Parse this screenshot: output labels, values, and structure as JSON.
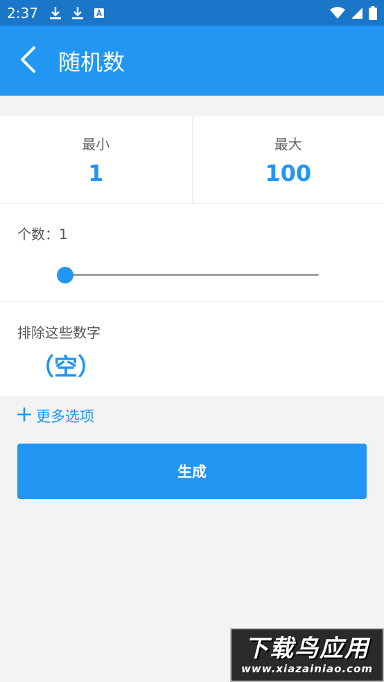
{
  "status_bar": {
    "time": "2:37",
    "left_icons": [
      "download-icon",
      "download-icon",
      "text-icon"
    ],
    "right_icons": [
      "wifi-icon",
      "signal-icon",
      "battery-icon"
    ]
  },
  "app_bar": {
    "title": "随机数",
    "back_icon": "chevron-left-icon"
  },
  "range": {
    "min_label": "最小",
    "min_value": "1",
    "max_label": "最大",
    "max_value": "100"
  },
  "count": {
    "label": "个数：1",
    "slider_fraction": 0
  },
  "exclude": {
    "label": "排除这些数字",
    "value": "（空）"
  },
  "more_options": {
    "icon": "plus-icon",
    "label": "更多选项"
  },
  "generate_button": {
    "label": "生成"
  },
  "watermark": {
    "main": "下载鸟应用",
    "sub": "www.xiazainiao.com"
  },
  "colors": {
    "status_bar": "#1976c8",
    "app_bar": "#2196f3",
    "accent": "#2196f3",
    "background": "#f3f3f3"
  }
}
